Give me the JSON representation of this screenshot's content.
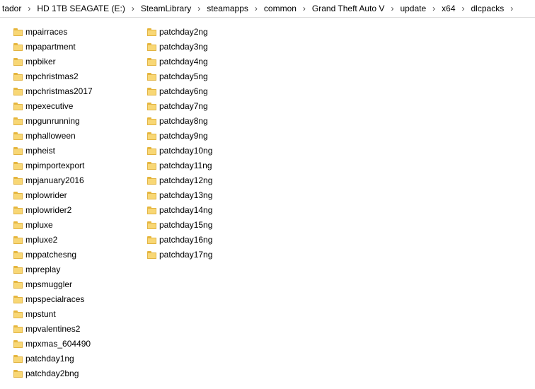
{
  "breadcrumb": [
    {
      "label": "tador"
    },
    {
      "label": "HD 1TB SEAGATE (E:)"
    },
    {
      "label": "SteamLibrary"
    },
    {
      "label": "steamapps"
    },
    {
      "label": "common"
    },
    {
      "label": "Grand Theft Auto V"
    },
    {
      "label": "update"
    },
    {
      "label": "x64"
    },
    {
      "label": "dlcpacks"
    }
  ],
  "separator_glyph": "›",
  "icons": {
    "breadcrumb_separator": "chevron-right-icon",
    "item": "folder-icon"
  },
  "colors": {
    "folder_fill": "#f8d775",
    "folder_border": "#e2b443"
  },
  "folders_col1": [
    "mpairraces",
    "mpapartment",
    "mpbiker",
    "mpchristmas2",
    "mpchristmas2017",
    "mpexecutive",
    "mpgunrunning",
    "mphalloween",
    "mpheist",
    "mpimportexport",
    "mpjanuary2016",
    "mplowrider",
    "mplowrider2",
    "mpluxe",
    "mpluxe2",
    "mppatchesng",
    "mpreplay",
    "mpsmuggler",
    "mpspecialraces",
    "mpstunt",
    "mpvalentines2",
    "mpxmas_604490",
    "patchday1ng",
    "patchday2bng"
  ],
  "folders_col2": [
    "patchday2ng",
    "patchday3ng",
    "patchday4ng",
    "patchday5ng",
    "patchday6ng",
    "patchday7ng",
    "patchday8ng",
    "patchday9ng",
    "patchday10ng",
    "patchday11ng",
    "patchday12ng",
    "patchday13ng",
    "patchday14ng",
    "patchday15ng",
    "patchday16ng",
    "patchday17ng"
  ]
}
